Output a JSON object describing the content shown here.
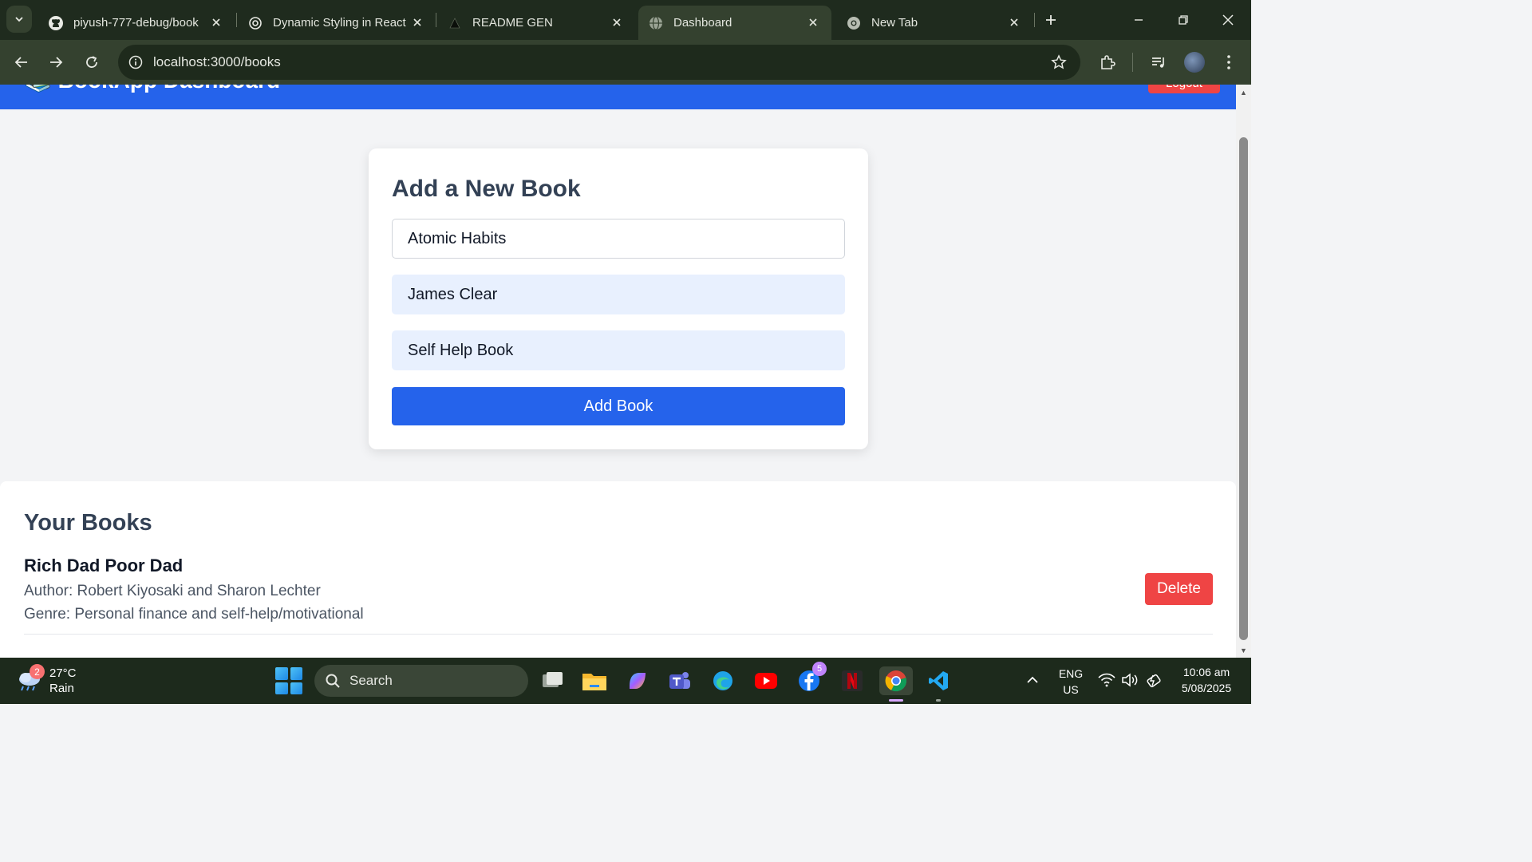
{
  "browser": {
    "tabs": [
      {
        "title": "piyush-777-debug/book",
        "favicon": "github-icon",
        "active": false
      },
      {
        "title": "Dynamic Styling in React",
        "favicon": "openai-icon",
        "active": false
      },
      {
        "title": "README GEN",
        "favicon": "triangle-icon",
        "active": false
      },
      {
        "title": "Dashboard",
        "favicon": "globe-icon",
        "active": true
      },
      {
        "title": "New Tab",
        "favicon": "chrome-icon",
        "active": false
      }
    ],
    "url": "localhost:3000/books"
  },
  "app": {
    "title": "📚 BookApp Dashboard",
    "logout_label": "Logout"
  },
  "form": {
    "heading": "Add a New Book",
    "title_value": "Atomic Habits",
    "author_value": "James Clear",
    "genre_value": "Self Help Book",
    "submit_label": "Add Book"
  },
  "books": {
    "heading": "Your Books",
    "items": [
      {
        "title": "Rich Dad Poor Dad",
        "author": "Author: Robert Kiyosaki and Sharon Lechter",
        "genre": "Genre: Personal finance and self-help/motivational",
        "delete_label": "Delete"
      }
    ]
  },
  "taskbar": {
    "weather_badge": "2",
    "temperature": "27°C",
    "condition": "Rain",
    "search_label": "Search",
    "facebook_badge": "5",
    "lang_line1": "ENG",
    "lang_line2": "US",
    "time": "10:06 am",
    "date": "5/08/2025"
  },
  "colors": {
    "primary": "#2563eb",
    "danger": "#ef4444",
    "chrome_bg": "#1f2b1e",
    "toolbar_bg": "#34412f"
  }
}
